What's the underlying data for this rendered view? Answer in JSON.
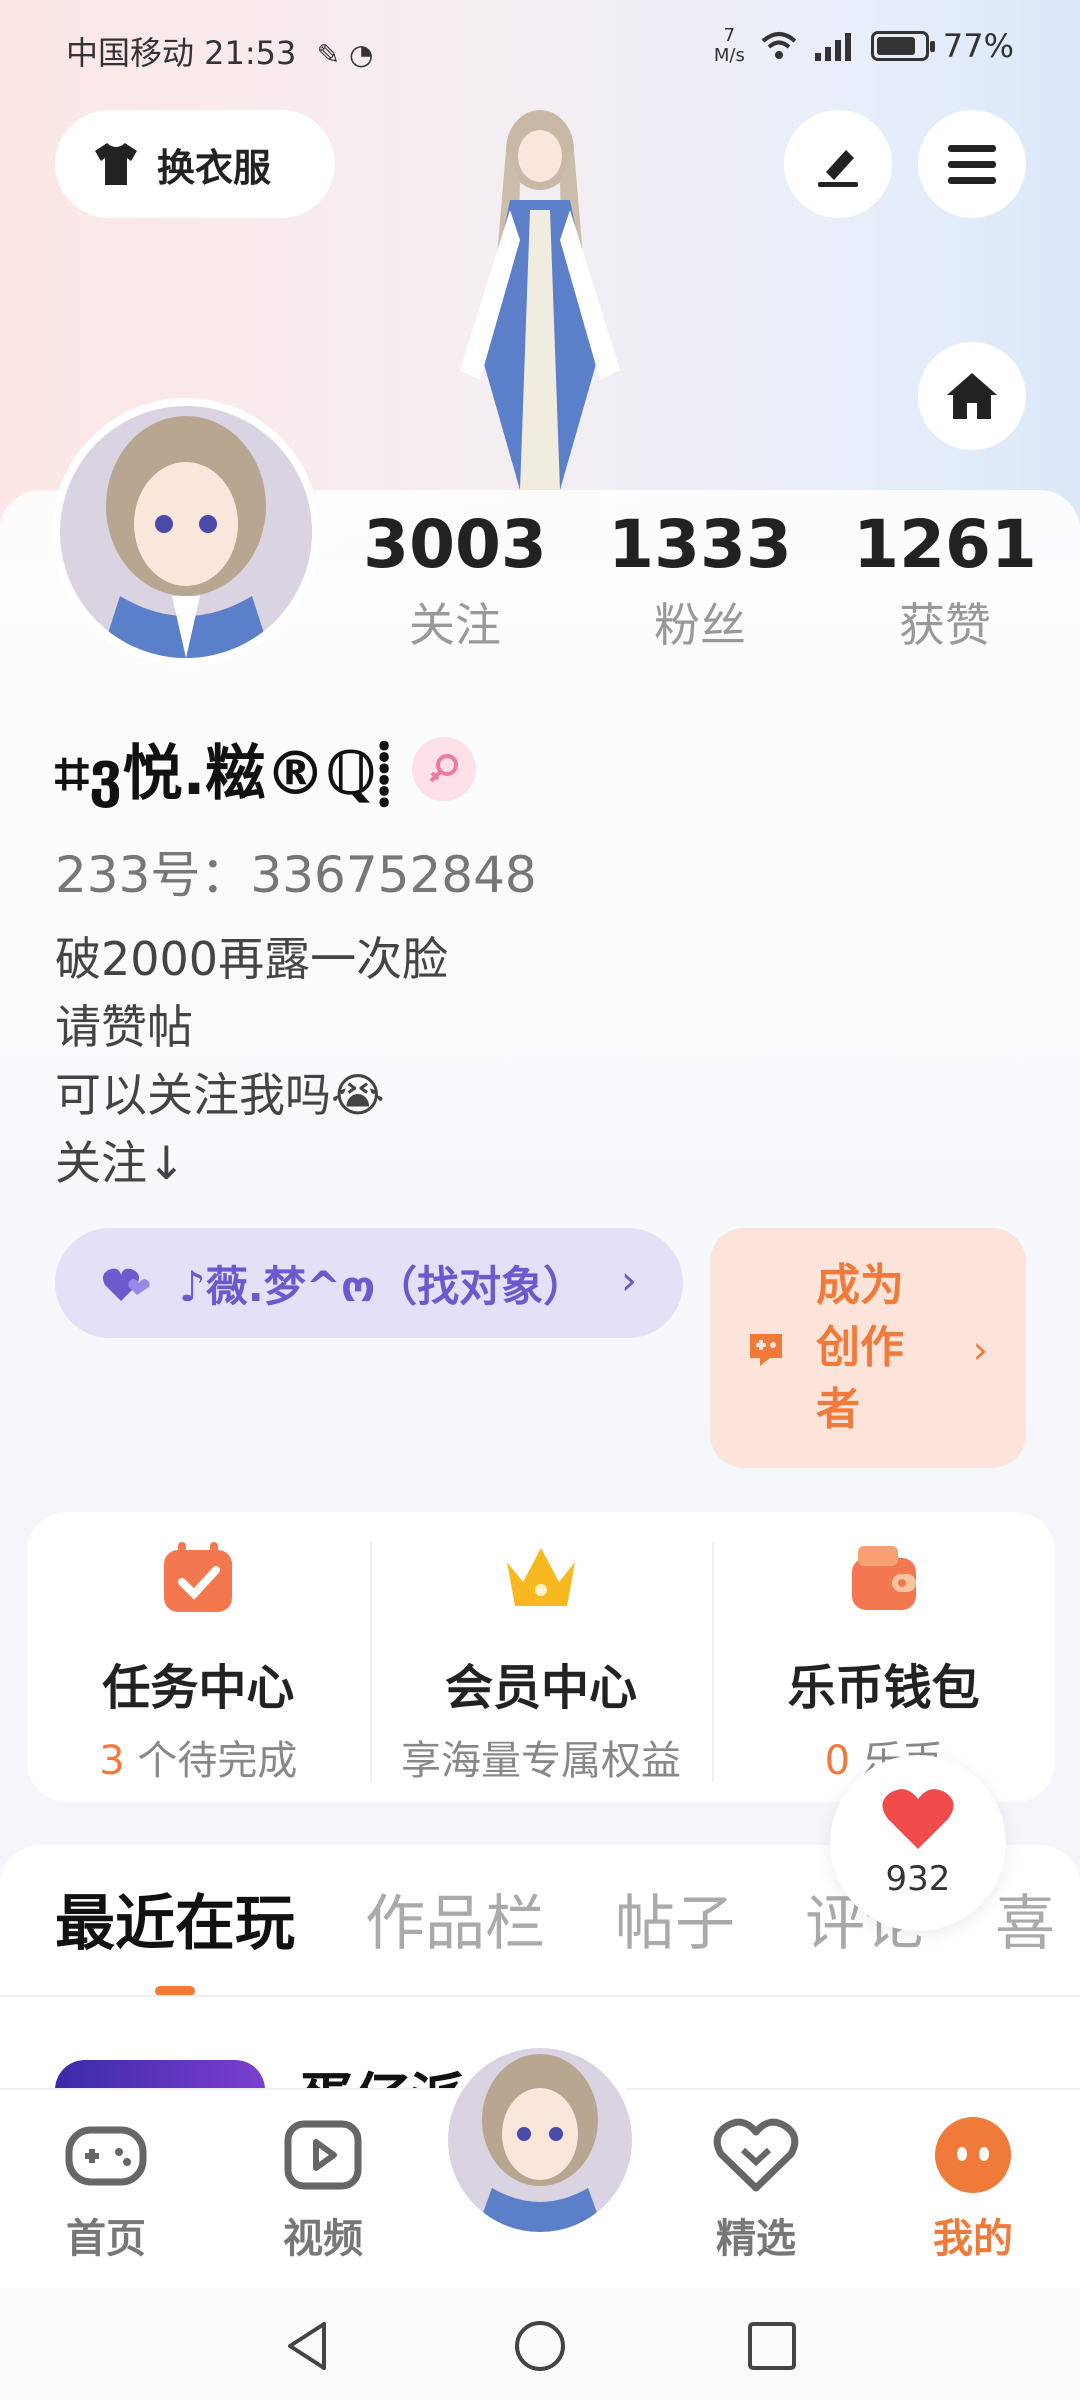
{
  "status_bar": {
    "carrier_time": "中国移动 21:53",
    "net_speed_value": "7",
    "net_speed_unit": "M/s",
    "battery": "77%"
  },
  "top": {
    "dress_label": "换衣服"
  },
  "stats": [
    {
      "num": "3003",
      "label": "关注"
    },
    {
      "num": "1333",
      "label": "粉丝"
    },
    {
      "num": "1261",
      "label": "获赞"
    }
  ],
  "profile": {
    "name": "⌗ვ悦.糍®ℚ⸽",
    "uid": "233号：336752848",
    "bio": [
      "破2000再露一次脸",
      "请赞帖",
      "可以关注我吗😭",
      "关注↓"
    ]
  },
  "group_pill": {
    "text": "♪薇.梦^ო（找对象）",
    "chevron": "›"
  },
  "creator": {
    "text": "成为创作者",
    "chevron": "›"
  },
  "features": [
    {
      "title": "任务中心",
      "count": "3",
      "sub": " 个待完成",
      "icon": "calendar-check-icon"
    },
    {
      "title": "会员中心",
      "count": "",
      "sub": "享海量专属权益",
      "icon": "crown-icon"
    },
    {
      "title": "乐币钱包",
      "count": "0",
      "sub": " 乐币",
      "icon": "wallet-icon"
    }
  ],
  "likes": {
    "count": "932"
  },
  "tabs": [
    "最近在玩",
    "作品栏",
    "帖子",
    "评论",
    "喜"
  ],
  "recent_peek_text": "蛋仔派",
  "nav": [
    {
      "label": "首页",
      "icon": "gamepad-icon"
    },
    {
      "label": "视频",
      "icon": "video-icon"
    },
    {
      "label": "精选",
      "icon": "heart-chat-icon"
    },
    {
      "label": "我的",
      "icon": "profile-face-icon"
    }
  ],
  "colors": {
    "accent": "#f07a3a",
    "purple": "#6a5acd",
    "like_red": "#f04a4a"
  }
}
